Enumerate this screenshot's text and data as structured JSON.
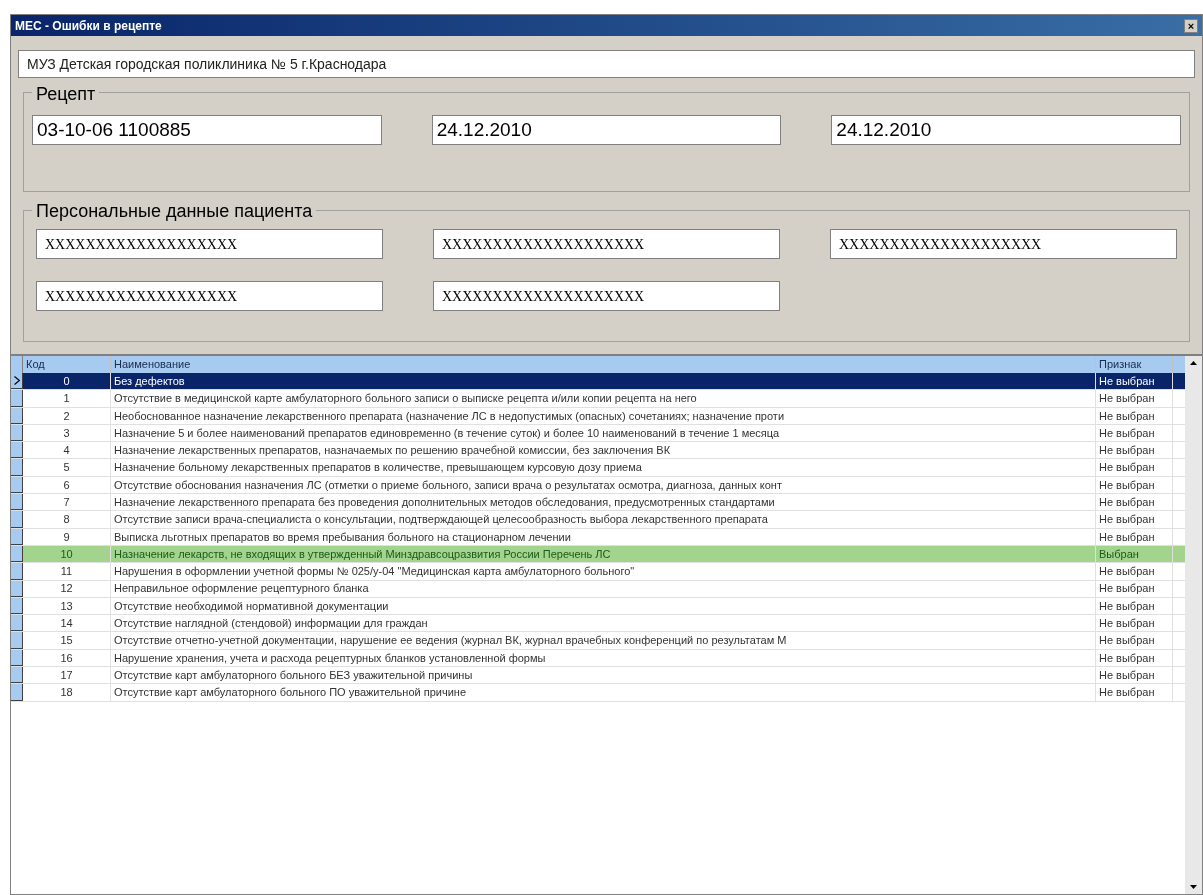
{
  "window": {
    "title": "МЕС - Ошибки в рецепте",
    "close": "×"
  },
  "organization": "МУЗ Детская городская поликлиника № 5 г.Краснодара",
  "prescription": {
    "title": "Рецепт",
    "fields": [
      "03-10-06 1100885",
      "24.12.2010",
      "24.12.2010"
    ]
  },
  "patient": {
    "title": "Персональные данные пациента",
    "fields": [
      "XXXXXXXXXXXXXXXXXXX",
      "XXXXXXXXXXXXXXXXXXXX",
      "XXXXXXXXXXXXXXXXXXXX",
      "XXXXXXXXXXXXXXXXXXX",
      "XXXXXXXXXXXXXXXXXXXX"
    ]
  },
  "table": {
    "columns": [
      "Код",
      "Наименование",
      "Признак"
    ],
    "rows": [
      {
        "code": "0",
        "name": "Без дефектов",
        "flag": "Не выбран",
        "current": true,
        "selected": false
      },
      {
        "code": "1",
        "name": "Отсутствие в медицинской карте амбулаторного больного записи о выписке рецепта и/или копии рецепта на него",
        "flag": "Не выбран",
        "current": false,
        "selected": false
      },
      {
        "code": "2",
        "name": "Необоснованное назначение лекарственного препарата (назначение ЛС в недопустимых (опасных) сочетаниях; назначение проти",
        "flag": "Не выбран",
        "current": false,
        "selected": false
      },
      {
        "code": "3",
        "name": "Назначение 5 и более наименований препаратов  единовременно (в течение суток) и  более 10 наименований в течение 1 месяца",
        "flag": "Не выбран",
        "current": false,
        "selected": false
      },
      {
        "code": "4",
        "name": "Назначение лекарственных препаратов, назначаемых по решению врачебной комиссии, без заключения ВК",
        "flag": "Не выбран",
        "current": false,
        "selected": false
      },
      {
        "code": "5",
        "name": "Назначение больному лекарственных препаратов в количестве, превышающем курсовую дозу приема",
        "flag": "Не выбран",
        "current": false,
        "selected": false
      },
      {
        "code": "6",
        "name": "Отсутствие обоснования назначения ЛС (отметки о приеме больного, записи врача о результатах осмотра, диагноза, данных конт",
        "flag": "Не выбран",
        "current": false,
        "selected": false
      },
      {
        "code": "7",
        "name": "Назначение лекарственного препарата без проведения дополнительных методов обследования, предусмотренных стандартами",
        "flag": "Не выбран",
        "current": false,
        "selected": false
      },
      {
        "code": "8",
        "name": "Отсутствие записи врача-специалиста о консультации, подтверждающей целесообразность выбора лекарственного препарата",
        "flag": "Не выбран",
        "current": false,
        "selected": false
      },
      {
        "code": "9",
        "name": "Выписка льготных препаратов во время пребывания больного на стационарном лечении",
        "flag": "Не выбран",
        "current": false,
        "selected": false
      },
      {
        "code": "10",
        "name": "Назначение лекарств, не входящих в утвержденный Минздравсоцразвития России  Перечень ЛС",
        "flag": "Выбран",
        "current": false,
        "selected": true
      },
      {
        "code": "11",
        "name": "Нарушения в оформлении учетной формы № 025/у-04 \"Медицинская карта амбулаторного больного\"",
        "flag": "Не выбран",
        "current": false,
        "selected": false
      },
      {
        "code": "12",
        "name": "Неправильное оформление рецептурного бланка",
        "flag": "Не выбран",
        "current": false,
        "selected": false
      },
      {
        "code": "13",
        "name": "Отсутствие необходимой нормативной документации",
        "flag": "Не выбран",
        "current": false,
        "selected": false
      },
      {
        "code": "14",
        "name": "Отсутствие наглядной (стендовой) информации для граждан",
        "flag": "Не выбран",
        "current": false,
        "selected": false
      },
      {
        "code": "15",
        "name": "Отсутствие отчетно-учетной документации, нарушение ее ведения (журнал ВК, журнал врачебных конференций по результатам М",
        "flag": "Не выбран",
        "current": false,
        "selected": false
      },
      {
        "code": "16",
        "name": "Нарушение хранения, учета и расхода рецептурных бланков установленной формы",
        "flag": "Не выбран",
        "current": false,
        "selected": false
      },
      {
        "code": "17",
        "name": "Отсутствие карт амбулаторного больного БЕЗ уважительной причины",
        "flag": "Не выбран",
        "current": false,
        "selected": false
      },
      {
        "code": "18",
        "name": "Отсутствие карт амбулаторного больного ПО уважительной причине",
        "flag": "Не выбран",
        "current": false,
        "selected": false
      }
    ]
  }
}
